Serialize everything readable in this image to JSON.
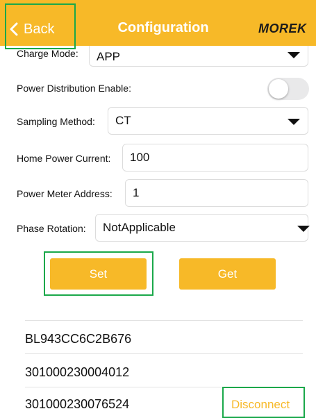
{
  "header": {
    "back_label": "Back",
    "title": "Configuration",
    "logo_text": "MOREK"
  },
  "form": {
    "charge_mode": {
      "label": "Charge Mode:",
      "value": "APP"
    },
    "power_distribution": {
      "label": "Power Distribution Enable:",
      "enabled": false
    },
    "sampling_method": {
      "label": "Sampling Method:",
      "value": "CT"
    },
    "home_power_current": {
      "label": "Home Power Current:",
      "value": "100"
    },
    "power_meter_address": {
      "label": "Power Meter Address:",
      "value": "1"
    },
    "phase_rotation": {
      "label": "Phase Rotation:",
      "value": "NotApplicable"
    }
  },
  "actions": {
    "set_label": "Set",
    "get_label": "Get"
  },
  "devices": [
    {
      "name": "BL943CC6C2B676"
    },
    {
      "name": "301000230004012"
    },
    {
      "name": "301000230076524",
      "action": "Disconnect"
    }
  ],
  "colors": {
    "accent": "#F7B928",
    "highlight": "#1aa84a"
  }
}
